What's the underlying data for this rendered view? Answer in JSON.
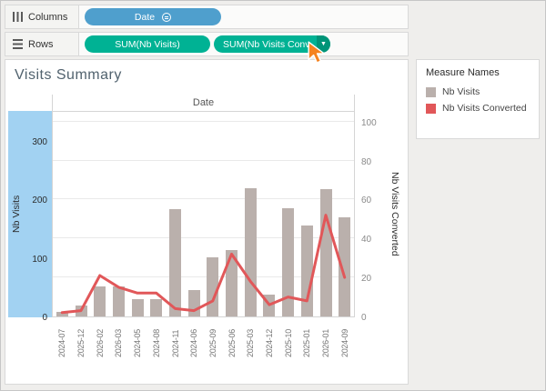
{
  "shelves": {
    "columns_label": "Columns",
    "rows_label": "Rows",
    "columns_pills": [
      {
        "text": "Date"
      }
    ],
    "rows_pills": [
      {
        "text": "SUM(Nb Visits)"
      },
      {
        "text": "SUM(Nb Visits Conv.."
      }
    ]
  },
  "icons": {
    "dropdown_caret": "▼"
  },
  "sheet_title": "Visits Summary",
  "legend": {
    "title": "Measure Names",
    "items": [
      {
        "label": "Nb Visits",
        "color": "#bab0ac"
      },
      {
        "label": "Nb Visits Converted",
        "color": "#e15759"
      }
    ]
  },
  "colors": {
    "dimension_pill": "#4f9fcd",
    "measure_pill": "#00b294",
    "measure_pill_caret": "#009478",
    "cursor_orange": "#f5821f",
    "axis_highlight": "#a2d2f2",
    "bar": "#bab0ac",
    "line": "#e15759"
  },
  "chart_data": {
    "type": "combo (bar + line, dual axis)",
    "title": "Visits Summary",
    "top_axis_label": "Date",
    "categories": [
      "2024-07",
      "2025-12",
      "2026-02",
      "2026-03",
      "2024-05",
      "2024-08",
      "2024-11",
      "2024-06",
      "2025-09",
      "2025-06",
      "2025-03",
      "2024-12",
      "2025-10",
      "2025-01",
      "2026-01",
      "2024-09"
    ],
    "series": [
      {
        "name": "Nb Visits",
        "type": "bar",
        "axis": "left",
        "color": "#bab0ac",
        "values": [
          8,
          18,
          52,
          52,
          30,
          30,
          183,
          45,
          101,
          114,
          220,
          38,
          185,
          155,
          218,
          170
        ]
      },
      {
        "name": "Nb Visits Converted",
        "type": "line",
        "axis": "right",
        "color": "#e15759",
        "values": [
          2,
          3,
          21,
          15,
          12,
          12,
          4,
          3,
          8,
          32,
          18,
          6,
          10,
          8,
          52,
          20
        ]
      }
    ],
    "left_axis": {
      "label": "Nb Visits",
      "ticks": [
        0,
        100,
        200,
        300
      ],
      "max": 350,
      "highlighted": true,
      "highlight_color": "#a2d2f2"
    },
    "right_axis": {
      "label": "Nb Visits Converted",
      "ticks": [
        0,
        20,
        40,
        60,
        80,
        100
      ],
      "max": 105
    },
    "gridlines": "horizontal at right-axis ticks",
    "legend_position": "right"
  }
}
